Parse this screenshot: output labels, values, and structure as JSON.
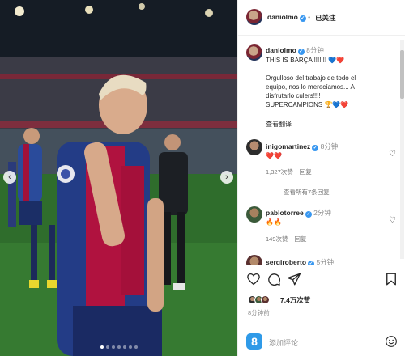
{
  "post": {
    "username": "daniolmo",
    "follow_status": "已关注",
    "photo_nav": {
      "prev_icon": "chevron-left-icon",
      "next_icon": "chevron-right-icon"
    },
    "carousel": {
      "count": 7,
      "active_index": 0
    }
  },
  "caption": {
    "username": "daniolmo",
    "time": "8分钟",
    "lines": [
      "THIS IS BARÇA !!!!!!! 💙❤️",
      "",
      "Orgulloso del trabajo de todo el",
      "equipo, nos lo merecíamos... A",
      "disfrutarlo culers!!!!",
      "SUPERCAMPIONS 🏆💙❤️"
    ],
    "see_translation": "查看翻译"
  },
  "comments": [
    {
      "username": "inigomartinez",
      "time": "8分钟",
      "text": "❤️❤️",
      "likes": "1,327次赞",
      "reply": "回复",
      "view_replies": "查看所有7条回复"
    },
    {
      "username": "pablotorree",
      "time": "2分钟",
      "text": "🔥🔥",
      "likes": "149次赞",
      "reply": "回复"
    },
    {
      "username": "sergiroberto",
      "time": "5分钟"
    }
  ],
  "actions": {
    "likes": "7.4万次赞",
    "posted": "8分钟前"
  },
  "add_comment": {
    "placeholder": "添加评论..."
  },
  "colors": {
    "verified": "#3897f0",
    "link": "#262626",
    "muted": "#8e8e8e",
    "barca_blue": "#1f3a8a",
    "barca_red": "#a50044"
  }
}
